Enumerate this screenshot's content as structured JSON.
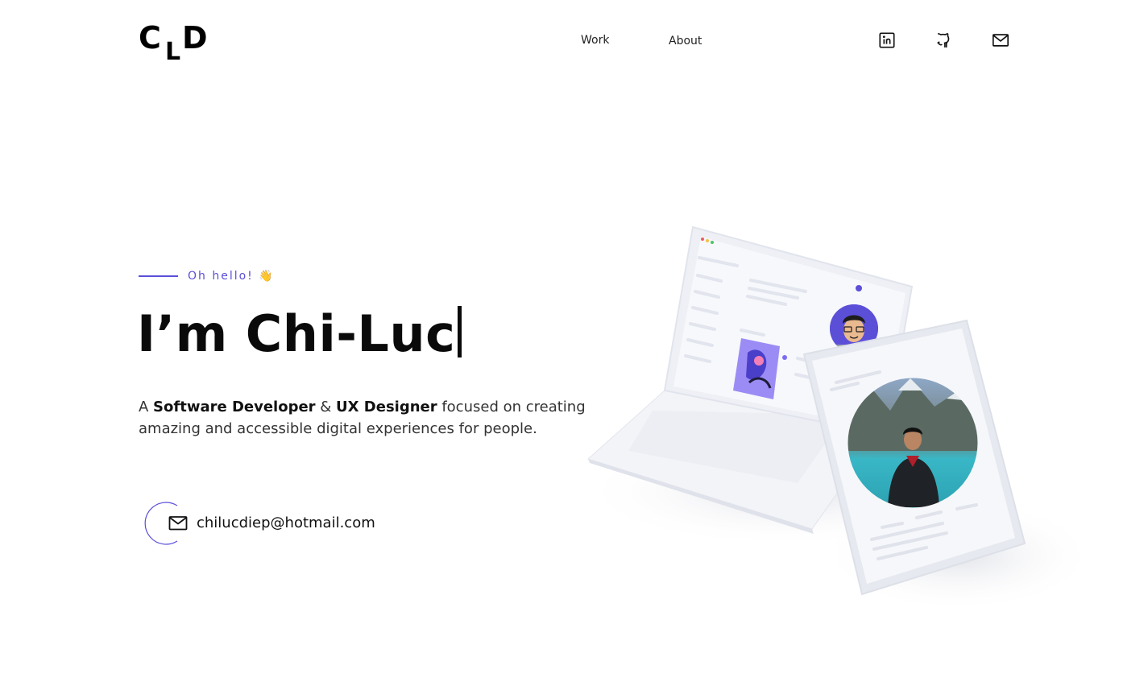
{
  "brand": {
    "logo_c": "C",
    "logo_l": "L",
    "logo_d": "D"
  },
  "nav": {
    "work": "Work",
    "about": "About"
  },
  "social": {
    "linkedin": "linkedin-icon",
    "github": "github-icon",
    "email": "mail-icon"
  },
  "hero": {
    "eyebrow": "Oh hello! 👋",
    "headline": "I’m Chi-Luc",
    "desc_a": "A ",
    "desc_role1": "Software Developer",
    "desc_amp": " & ",
    "desc_role2": "UX Designer",
    "desc_rest": " focused on creating amazing and accessible digital experiences for people.",
    "email": "chilucdiep@hotmail.com"
  },
  "colors": {
    "accent": "#5b4fd8",
    "text": "#111111",
    "device": "#eef0f6"
  }
}
